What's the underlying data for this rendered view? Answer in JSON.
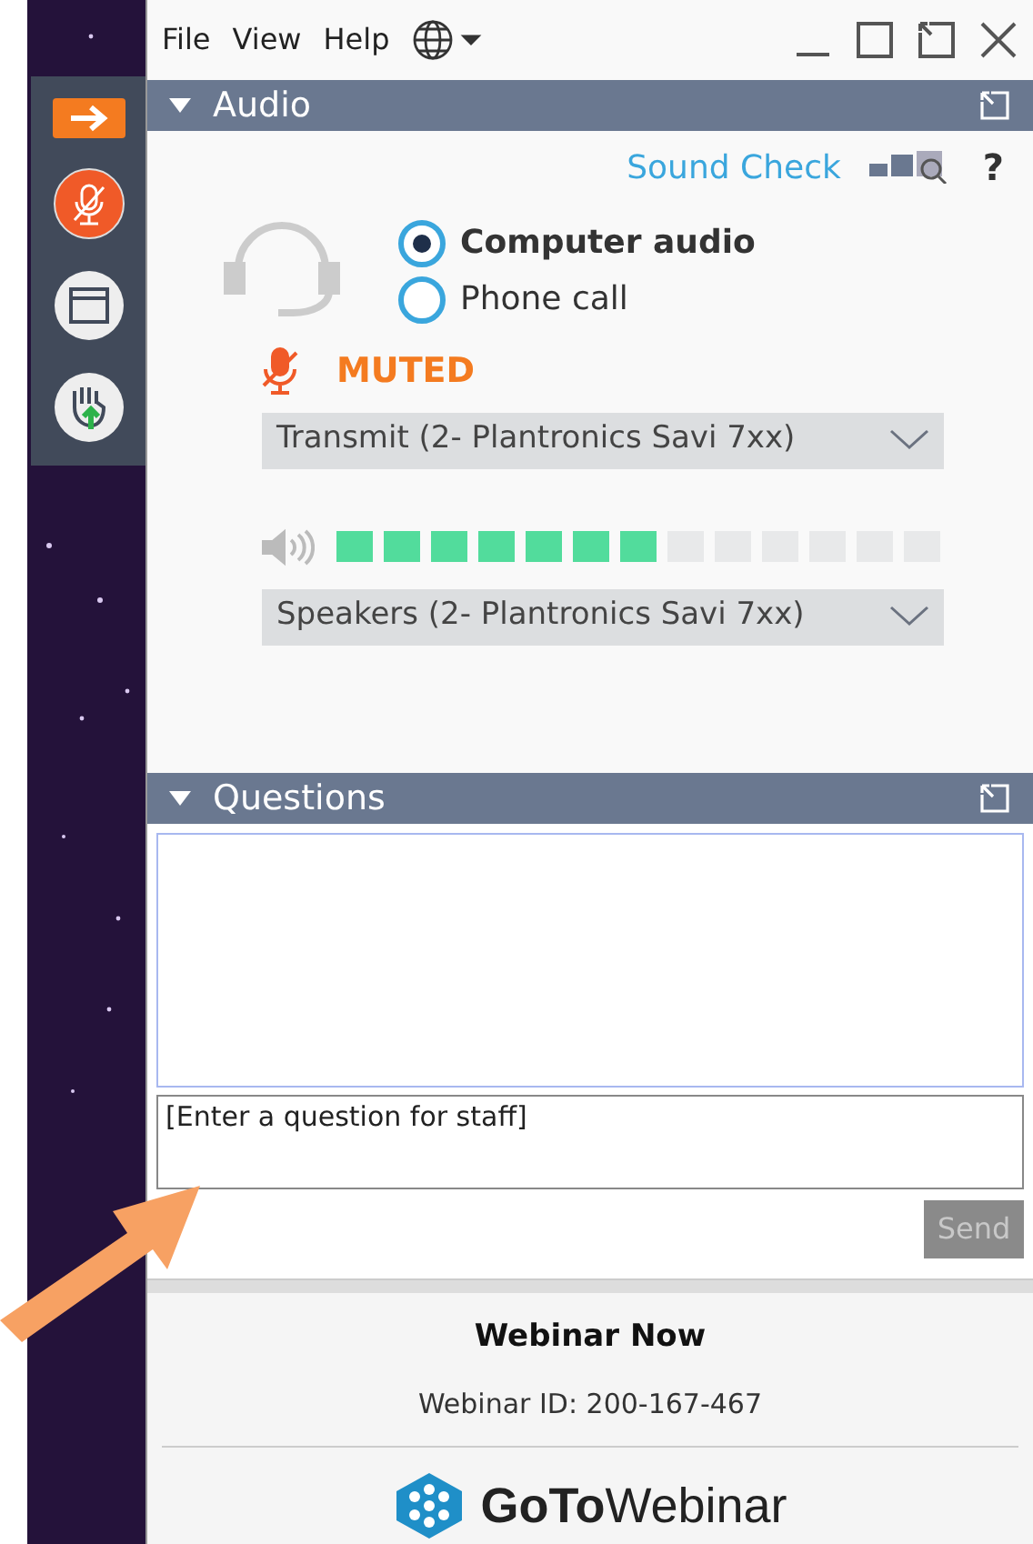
{
  "menu": [
    "File",
    "View",
    "Help"
  ],
  "audio": {
    "title": "Audio",
    "expanded": true,
    "sound_check": "Sound Check",
    "help": "?",
    "options": [
      {
        "label": "Computer audio",
        "selected": true
      },
      {
        "label": "Phone call",
        "selected": false
      }
    ],
    "muted": true,
    "status": "MUTED",
    "transmit": "Transmit (2- Plantronics Savi 7xx)",
    "speaker_meter": {
      "level": 0.53
    },
    "speakers": "Speakers (2- Plantronics Savi 7xx)"
  },
  "questions": {
    "title": "Questions",
    "expanded": true,
    "input_value": "[Enter a question for staff]",
    "send": {
      "label": "Send",
      "disabled": true
    }
  },
  "footer": {
    "name": "Webinar Now",
    "id": "Webinar ID: 200-167-467",
    "logo": "**GoTo**Webinar"
  }
}
